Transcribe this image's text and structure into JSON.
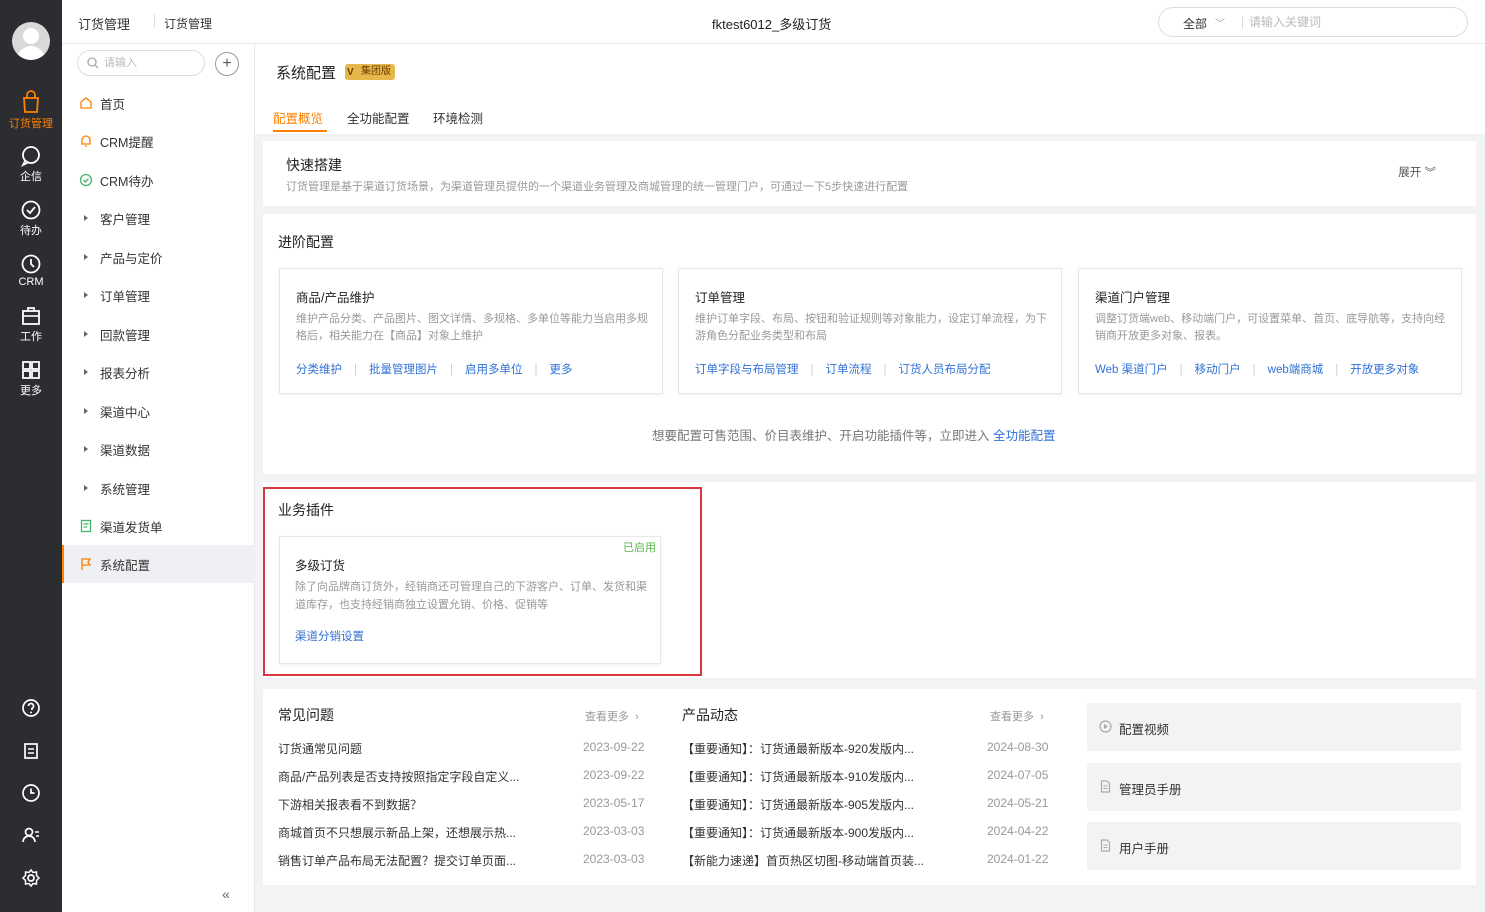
{
  "rail": {
    "items": [
      {
        "label": "订货管理",
        "icon": "bag-icon"
      },
      {
        "label": "企信",
        "icon": "chat-icon"
      },
      {
        "label": "待办",
        "icon": "check-circle-icon"
      },
      {
        "label": "CRM",
        "icon": "crm-icon"
      },
      {
        "label": "工作",
        "icon": "briefcase-icon"
      },
      {
        "label": "更多",
        "icon": "grid-icon"
      }
    ]
  },
  "topbar": {
    "crumb_primary": "订货管理",
    "crumb_secondary": "订货管理",
    "app_title": "fktest6012_多级订货",
    "search_scope": "全部",
    "search_placeholder": "请输入关键词"
  },
  "subnav": {
    "search_placeholder": "请输入",
    "items": [
      {
        "label": "首页"
      },
      {
        "label": "CRM提醒"
      },
      {
        "label": "CRM待办"
      },
      {
        "label": "客户管理"
      },
      {
        "label": "产品与定价"
      },
      {
        "label": "订单管理"
      },
      {
        "label": "回款管理"
      },
      {
        "label": "报表分析"
      },
      {
        "label": "渠道中心"
      },
      {
        "label": "渠道数据"
      },
      {
        "label": "系统管理"
      },
      {
        "label": "渠道发货单"
      },
      {
        "label": "系统配置"
      }
    ]
  },
  "page": {
    "title": "系统配置",
    "badge": "集团版",
    "tabs": [
      "配置概览",
      "全功能配置",
      "环境检测"
    ]
  },
  "quick": {
    "title": "快速搭建",
    "desc": "订货管理是基于渠道订货场景，为渠道管理员提供的一个渠道业务管理及商城管理的统一管理门户，可通过一下5步快速进行配置",
    "expand": "展开"
  },
  "advanced": {
    "title": "进阶配置",
    "cards": [
      {
        "title": "商品/产品维护",
        "desc": "维护产品分类、产品图片、图文详情、多规格、多单位等能力当启用多规格后，相关能力在【商品】对象上维护",
        "links": [
          "分类维护",
          "批量管理图片",
          "启用多单位",
          "更多"
        ]
      },
      {
        "title": "订单管理",
        "desc": "维护订单字段、布局、按钮和验证规则等对象能力，设定订单流程，为下游角色分配业务类型和布局",
        "links": [
          "订单字段与布局管理",
          "订单流程",
          "订货人员布局分配"
        ]
      },
      {
        "title": "渠道门户管理",
        "desc": "调整订货端web、移动端门户，可设置菜单、首页、底导航等，支持向经销商开放更多对象、报表。",
        "links": [
          "Web 渠道门户",
          "移动门户",
          "web端商城",
          "开放更多对象"
        ]
      }
    ],
    "hint_text": "想要配置可售范围、价目表维护、开启功能插件等，立即进入",
    "hint_link": "全功能配置"
  },
  "plugins": {
    "title": "业务插件",
    "card": {
      "status": "已启用",
      "title": "多级订货",
      "desc": "除了向品牌商订货外，经销商还可管理自己的下游客户、订单、发货和渠道库存，也支持经销商独立设置允销、价格、促销等",
      "link": "渠道分销设置"
    }
  },
  "faq": {
    "title": "常见问题",
    "more": "查看更多",
    "rows": [
      {
        "text": "订货通常见问题",
        "date": "2023-09-22"
      },
      {
        "text": "商品/产品列表是否支持按照指定字段自定义...",
        "date": "2023-09-22"
      },
      {
        "text": "下游相关报表看不到数据？",
        "date": "2023-05-17"
      },
      {
        "text": "商城首页不只想展示新品上架，还想展示热...",
        "date": "2023-03-03"
      },
      {
        "text": "销售订单产品布局无法配置？提交订单页面...",
        "date": "2023-03-03"
      }
    ]
  },
  "news": {
    "title": "产品动态",
    "more": "查看更多",
    "rows": [
      {
        "text": "【重要通知】：订货通最新版本-920发版内...",
        "date": "2024-08-30"
      },
      {
        "text": "【重要通知】：订货通最新版本-910发版内...",
        "date": "2024-07-05"
      },
      {
        "text": "【重要通知】：订货通最新版本-905发版内...",
        "date": "2024-05-21"
      },
      {
        "text": "【重要通知】：订货通最新版本-900发版内...",
        "date": "2024-04-22"
      },
      {
        "text": "【新能力速递】首页热区切图-移动端首页装...",
        "date": "2024-01-22"
      }
    ]
  },
  "resources": [
    {
      "label": "配置视频",
      "icon": "play-icon"
    },
    {
      "label": "管理员手册",
      "icon": "document-icon"
    },
    {
      "label": "用户手册",
      "icon": "document-icon"
    }
  ],
  "colors": {
    "accent": "#ff8000",
    "link": "#3071d6",
    "rail": "#2b2d31",
    "highlight": "#d9363e",
    "enabled": "#5bb34a"
  }
}
